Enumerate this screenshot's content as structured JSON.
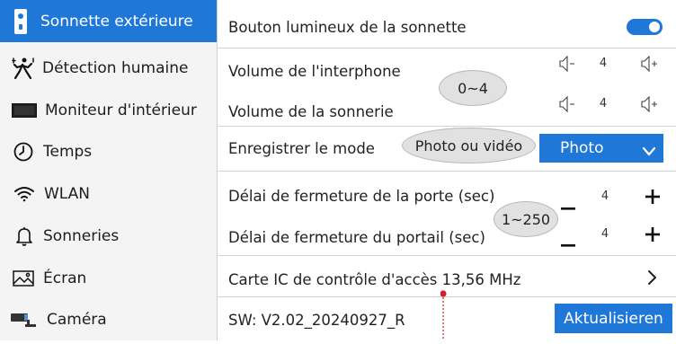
{
  "sidebar": {
    "items": [
      {
        "label": "Sonnette extérieure",
        "icon": "doorbell-icon",
        "active": true
      },
      {
        "label": "Détection humaine",
        "icon": "running-person-icon"
      },
      {
        "label": "Moniteur d'intérieur",
        "icon": "monitor-icon"
      },
      {
        "label": "Temps",
        "icon": "clock-icon"
      },
      {
        "label": "WLAN",
        "icon": "wifi-icon"
      },
      {
        "label": "Sonneries",
        "icon": "bell-icon"
      },
      {
        "label": "Écran",
        "icon": "image-icon"
      },
      {
        "label": "Caméra",
        "icon": "camera-icon"
      }
    ]
  },
  "settings": {
    "button_light": {
      "label": "Bouton lumineux de la sonnette",
      "enabled": true
    },
    "intercom_volume": {
      "label": "Volume de l'interphone",
      "value": "4"
    },
    "ring_volume": {
      "label": "Volume de la sonnerie",
      "value": "4"
    },
    "volume_range_note": "0~4",
    "record_mode": {
      "label": "Enregistrer le mode",
      "value": "Photo",
      "note": "Photo ou vidéo"
    },
    "door_delay": {
      "label": "Délai de fermeture de la porte (sec)",
      "value": "4"
    },
    "gate_delay": {
      "label": "Délai de fermeture du portail (sec)",
      "value": "4"
    },
    "delay_range_note": "1~250",
    "ic_card": {
      "label": "Carte IC de contrôle d'accès 13,56 MHz"
    },
    "software": {
      "label": "SW: V2.02_20240927_R",
      "update_button": "Aktualisieren"
    }
  },
  "colors": {
    "accent": "#1f77d8",
    "sidebar_bg": "#f4f4f4",
    "annotation_red": "#d21f2a"
  }
}
